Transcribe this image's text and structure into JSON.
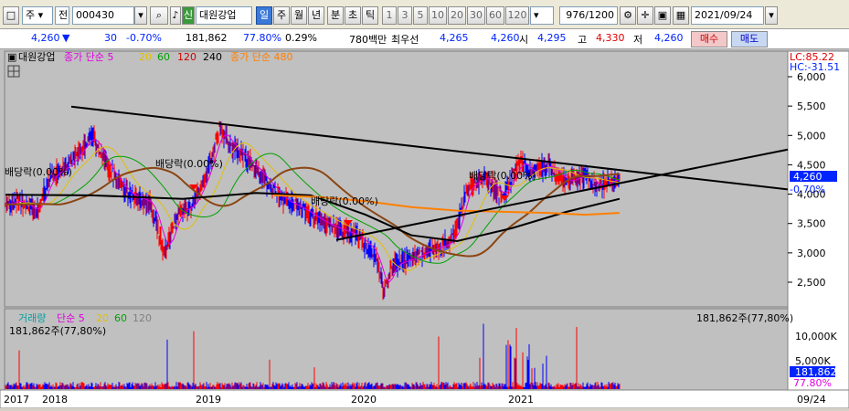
{
  "toolbar": {
    "period_select": "주",
    "market_select": "전",
    "stock_code": "000430",
    "stock_name": "대원강업",
    "badge": "신",
    "periods": [
      "일",
      "주",
      "월",
      "년",
      "분",
      "초",
      "틱"
    ],
    "active_period": "일",
    "tick_intervals": [
      "1",
      "3",
      "5",
      "10",
      "20",
      "30",
      "60",
      "120"
    ],
    "bar_count": "976",
    "bar_total": "/1200",
    "date": "2021/09/24"
  },
  "quote": {
    "price": "4,260",
    "change_arrow": "▼",
    "change": "30",
    "change_pct": "-0.70%",
    "volume": "181,862",
    "volume_ratio": "77.80%",
    "turnover": "0.29%",
    "amount": "780백만",
    "best_label": "최우선",
    "ask": "4,265",
    "bid": "4,260",
    "open_label": "시",
    "open": "4,295",
    "high_label": "고",
    "high": "4,330",
    "low_label": "저",
    "low": "4,260",
    "buy_label": "매수",
    "sell_label": "매도"
  },
  "chart": {
    "legend_name": "대원강업",
    "legend_ma": "종가 단순 5",
    "legend_ma_periods": [
      "20",
      "60",
      "120",
      "240"
    ],
    "legend_ma2": "종가 단순 480",
    "lc_label": "LC:85.22",
    "hc_label": "HC:-31.51",
    "price_axis": [
      "6,000",
      "5,500",
      "5,000",
      "4,500",
      "4,000",
      "3,500",
      "3,000",
      "2,500"
    ],
    "current_price_tag": "4,260",
    "current_pct_tag": "-0.70%",
    "annotations": [
      "배당락(0.00%)",
      "배당락(0.00%)",
      "배당락(0.00%)",
      "배당락(0.00%)"
    ],
    "colors": {
      "ma5": "#e000e0",
      "ma20": "#e0c000",
      "ma60": "#00a000",
      "ma120": "#d00000",
      "ma240": "#000000",
      "ma480": "#ff7f00",
      "candle_up": "#ff0000",
      "candle_down": "#0000ff",
      "ma_long_brown": "#8b4513"
    }
  },
  "volume": {
    "legend_name": "거래량",
    "legend_ma": "단순 5",
    "legend_periods": [
      "20",
      "60",
      "120"
    ],
    "left_value": "181,862주(77,80%)",
    "right_value": "181,862주(77,80%)",
    "axis": [
      "10,000K",
      "5,000K"
    ],
    "current_tag": "181,862",
    "pct_tag": "77.80%"
  },
  "time_axis": {
    "labels": [
      "2017",
      "2018",
      "2019",
      "2020",
      "2021"
    ],
    "right_label": "09/24"
  }
}
